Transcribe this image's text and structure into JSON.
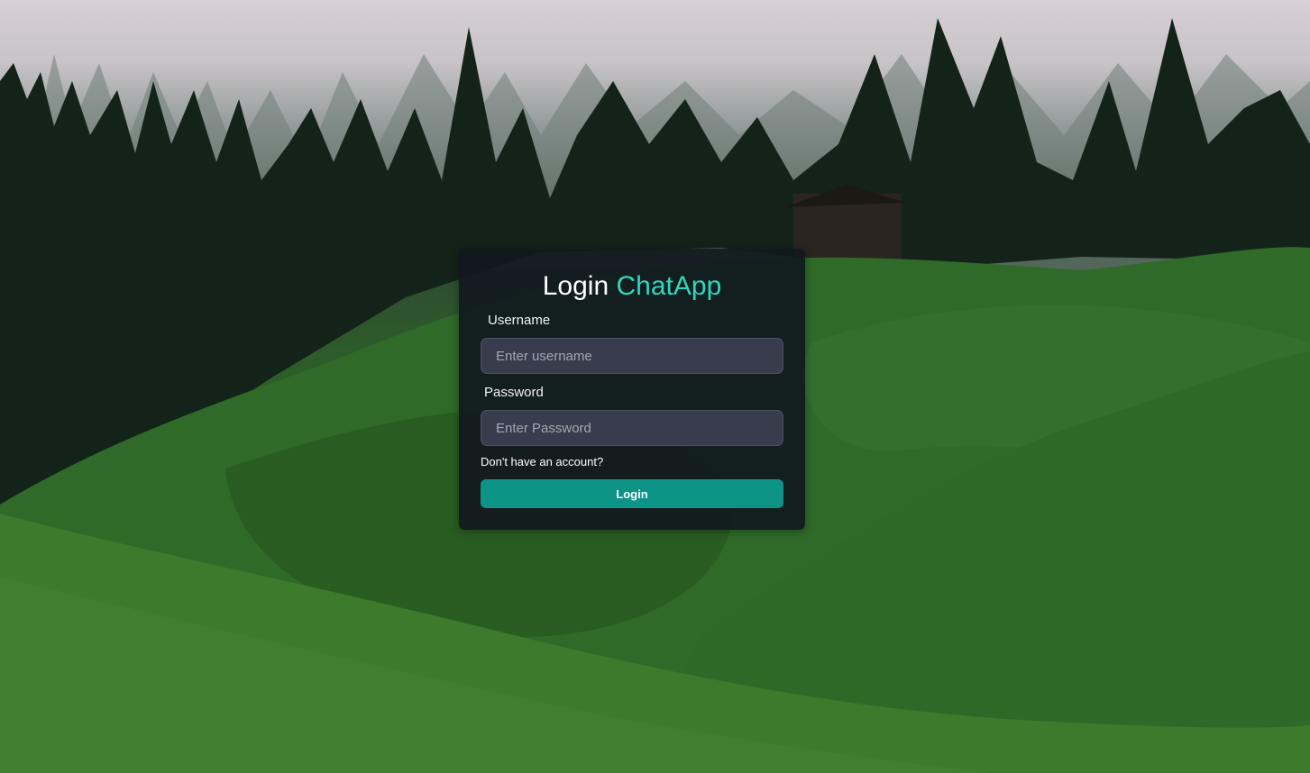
{
  "login": {
    "title_prefix": "Login",
    "title_accent": "ChatApp",
    "username_label": "Username",
    "username_placeholder": "Enter username",
    "password_label": "Password",
    "password_placeholder": "Enter Password",
    "signup_link": "Don't have an account?",
    "login_button": "Login"
  },
  "theme": {
    "accent": "#2fd6bd",
    "button": "#0e9486",
    "card_bg": "#11181e",
    "input_bg": "#383c4c"
  }
}
